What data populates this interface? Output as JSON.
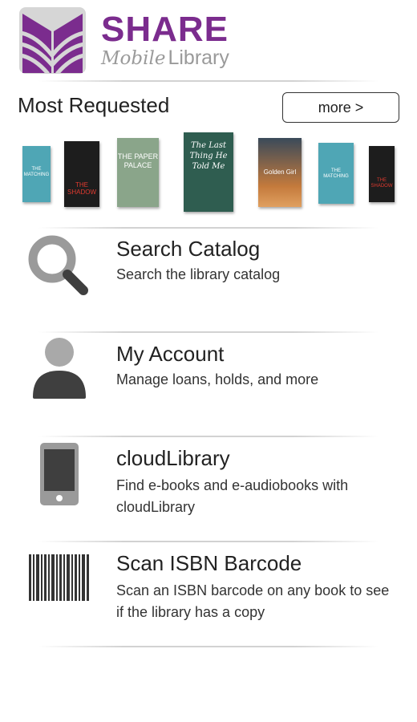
{
  "header": {
    "brand_name": "SHARE",
    "brand_sub_mobile": "Mobile",
    "brand_sub_library": "Library",
    "brand_color": "#7b2c8e"
  },
  "most_requested": {
    "title": "Most Requested",
    "more_label": "more >",
    "books": [
      {
        "cover_text": "THE MATCHING",
        "color": "#4fa6b5"
      },
      {
        "cover_text": "THE SHADOW",
        "color": "#1d1d1d"
      },
      {
        "cover_text": "THE PAPER PALACE",
        "color": "#8aa58a"
      },
      {
        "cover_text": "The Last Thing He Told Me",
        "color": "#2f5d50"
      },
      {
        "cover_text": "Golden Girl",
        "color": "#c47a3c"
      },
      {
        "cover_text": "THE MATCHING",
        "color": "#4fa6b5"
      },
      {
        "cover_text": "THE SHADOW",
        "color": "#1d1d1d"
      }
    ]
  },
  "menu": [
    {
      "icon": "search-icon",
      "title": "Search Catalog",
      "desc": "Search the library catalog"
    },
    {
      "icon": "user-icon",
      "title": "My Account",
      "desc": "Manage loans, holds, and more"
    },
    {
      "icon": "phone-icon",
      "title": "cloudLibrary",
      "desc": "Find e-books and e-audiobooks with cloudLibrary"
    },
    {
      "icon": "barcode-icon",
      "title": "Scan ISBN Barcode",
      "desc": "Scan an ISBN barcode on any book to see if the library has a copy"
    }
  ]
}
